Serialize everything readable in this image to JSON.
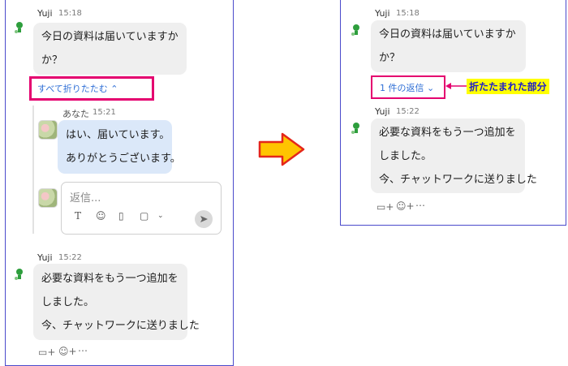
{
  "left": {
    "msg1": {
      "sender": "Yuji",
      "time": "15:18",
      "lines": [
        "今日の資料は届いていますか",
        "か？"
      ]
    },
    "collapse_label": "すべて折りたたむ",
    "chevron": "chevron-up-icon",
    "reply1": {
      "sender": "あなた",
      "time": "15:21",
      "lines": [
        "はい、届いています。",
        "ありがとうございます。"
      ]
    },
    "reply_input": {
      "placeholder": "返信..."
    },
    "reply_tools": [
      "text-format-icon",
      "emoji-icon",
      "file-icon",
      "screenshot-icon",
      "chevron-down-icon",
      "send-icon"
    ],
    "msg2": {
      "sender": "Yuji",
      "time": "15:22",
      "lines": [
        "必要な資料をもう一つ追加を",
        "しました。",
        "今、チャットワークに送りました"
      ]
    },
    "actions": [
      "reply-add-icon",
      "reaction-icon",
      "more-icon"
    ]
  },
  "right": {
    "msg1": {
      "sender": "Yuji",
      "time": "15:18",
      "lines": [
        "今日の資料は届いていますか",
        "か？"
      ]
    },
    "reply_count_label": "1 件の返信",
    "chevron": "chevron-down-icon",
    "callout": "折たたまれた部分",
    "msg2": {
      "sender": "Yuji",
      "time": "15:22",
      "lines": [
        "必要な資料をもう一つ追加を",
        "しました。",
        "今、チャットワークに送りました"
      ]
    },
    "actions": [
      "reply-add-icon",
      "reaction-icon",
      "more-icon"
    ]
  },
  "colors": {
    "panel_border": "#4a4acb",
    "highlight": "#e4006f",
    "link": "#2f6fd6",
    "arrow_fill": "#ffc400",
    "arrow_stroke": "#e4261b",
    "callout_bg": "#ffff00"
  }
}
